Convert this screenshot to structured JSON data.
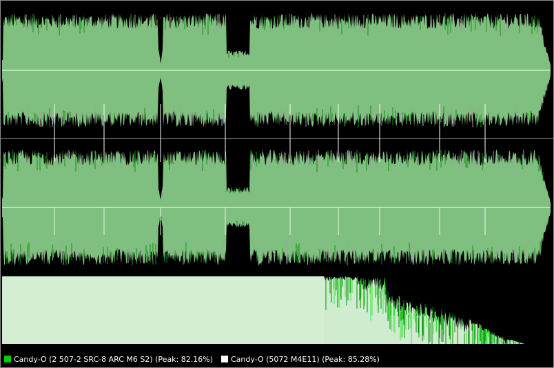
{
  "colors": {
    "background": "#000000",
    "wave_fill": "#7fbf7f",
    "wave_dark": "#1a8f1a",
    "wave_gray": "#a0a0a0",
    "center_line": "#c8f0c8",
    "divider": "#9aa0a8",
    "spectrum_fill": "#cfeccf",
    "spectrum_dark": "#0a8a0a",
    "spectrum_bright": "#39e639"
  },
  "legend": [
    {
      "label": "Candy-O (2 507-2 SRC-8 ARC M6 S2) (Peak: 82.16%)",
      "color": "#00cc00"
    },
    {
      "label": "Candy-O (5072 M4E11) (Peak: 85.28%)",
      "color": "#ffffff"
    }
  ]
}
